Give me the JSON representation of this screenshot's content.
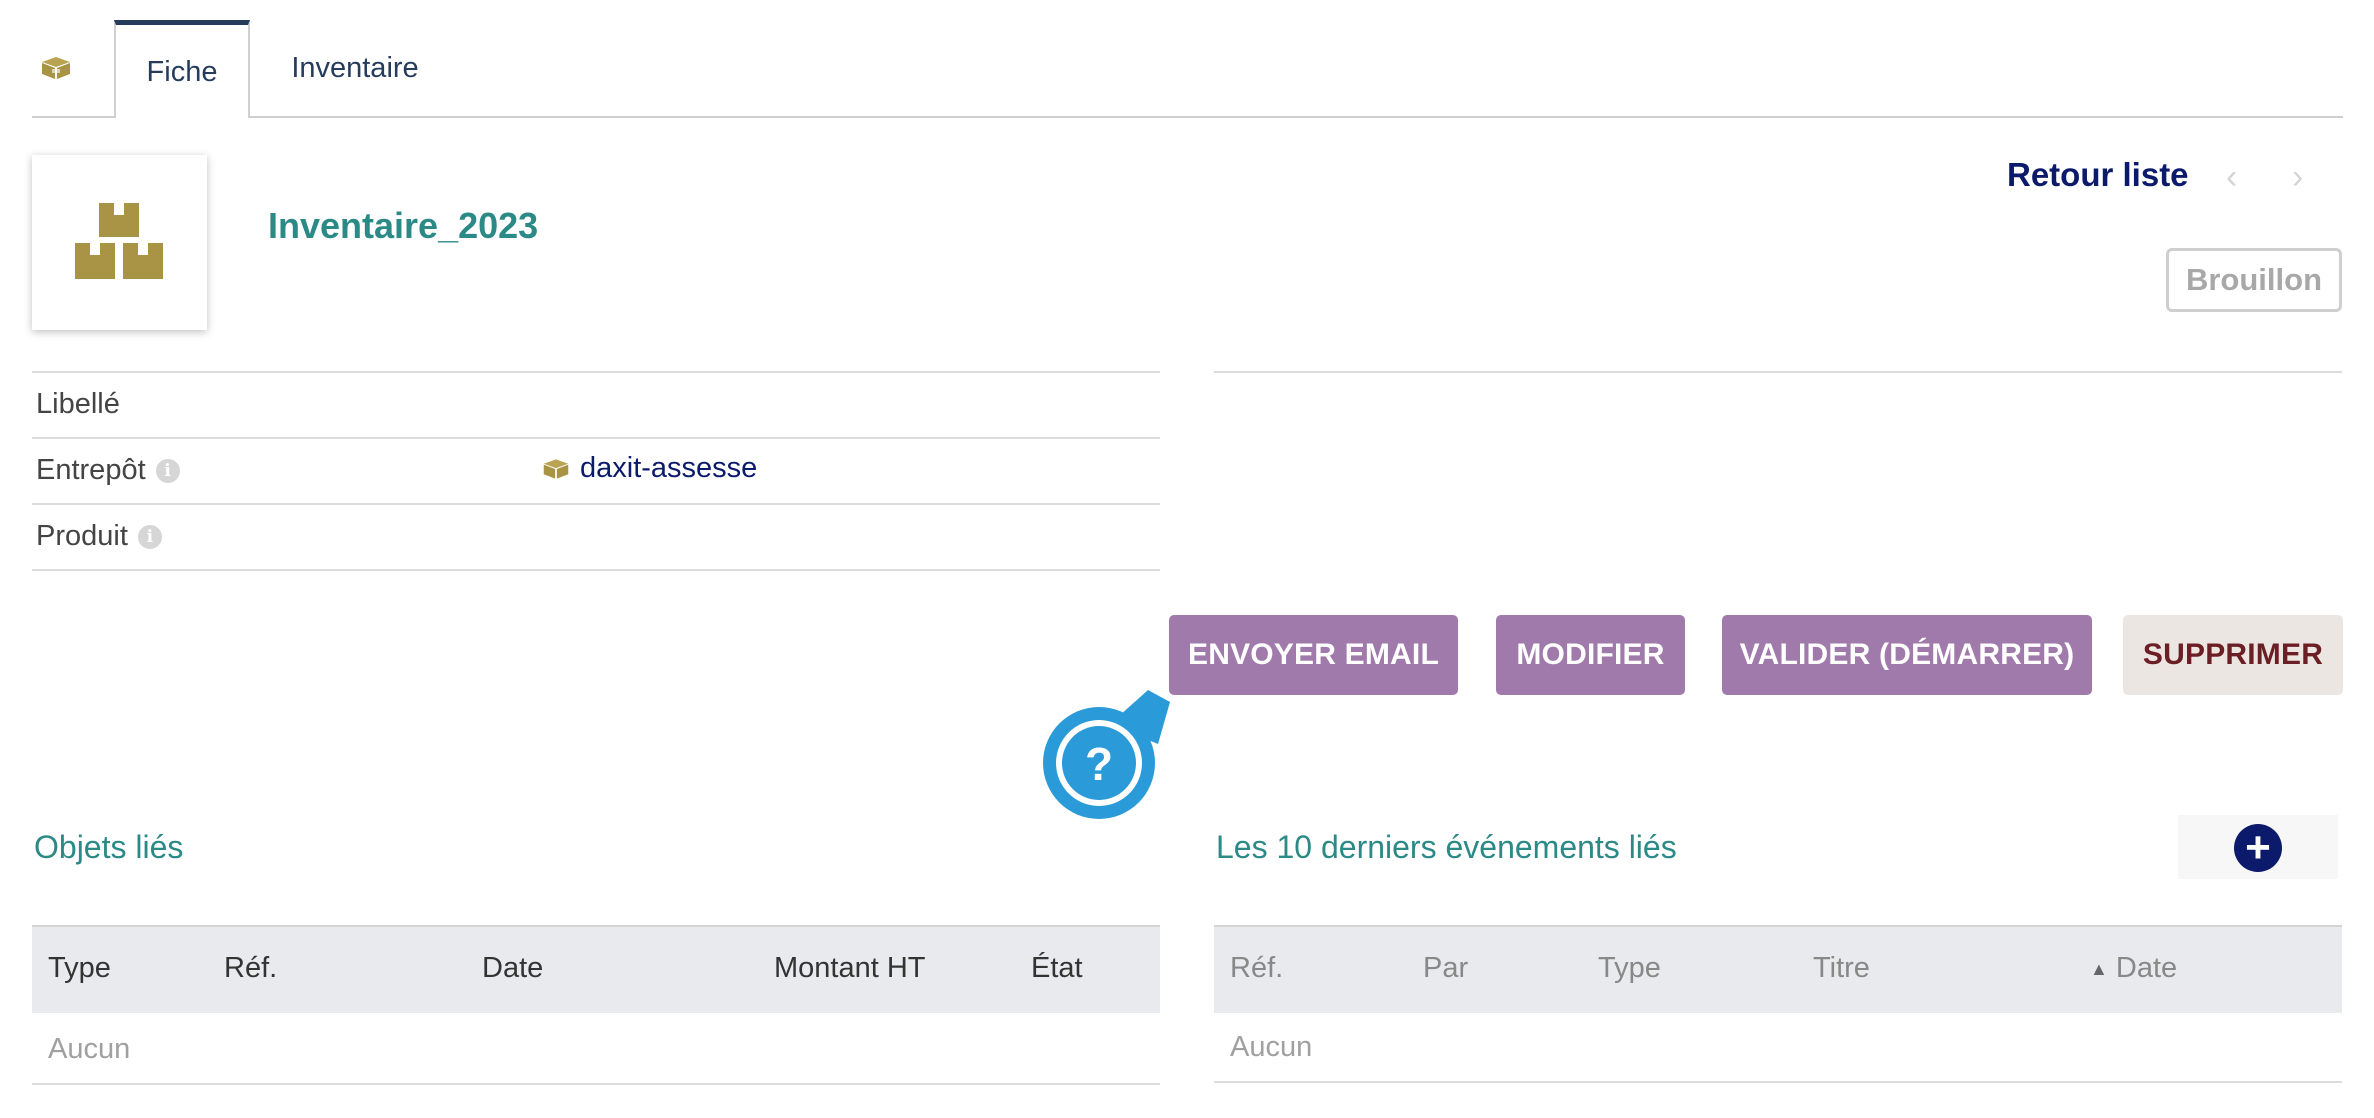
{
  "tabs": [
    {
      "label": "Fiche",
      "active": true
    },
    {
      "label": "Inventaire",
      "active": false
    }
  ],
  "tab_icon": "boxes-icon",
  "object": {
    "ref": "Inventaire_2023",
    "thumbnail_icon": "boxes-icon",
    "status": "Brouillon"
  },
  "nav": {
    "back_label": "Retour liste",
    "prev_icon": "chevron-left-icon",
    "next_icon": "chevron-right-icon"
  },
  "fields": [
    {
      "label": "Libellé",
      "value": ""
    },
    {
      "label": "Entrepôt",
      "value": "daxit-assesse",
      "info_icon": "info-icon"
    },
    {
      "label": "Produit",
      "value": "",
      "info_icon": "info-icon"
    }
  ],
  "actions": {
    "send_email": "ENVOYER EMAIL",
    "modify": "MODIFIER",
    "validate": "VALIDER (DÉMARRER)",
    "delete": "SUPPRIMER"
  },
  "help": {
    "symbol": "?"
  },
  "linked_objects": {
    "title": "Objets liés",
    "columns": [
      "Type",
      "Réf.",
      "Date",
      "Montant HT",
      "État"
    ],
    "empty_text": "Aucun"
  },
  "events": {
    "title": "Les 10 derniers événements liés",
    "columns": [
      "Réf.",
      "Par",
      "Type",
      "Titre",
      "Date"
    ],
    "sort_column": "Date",
    "sort_direction": "asc",
    "empty_text": "Aucun",
    "add_icon": "plus-circle-icon"
  },
  "colors": {
    "nav_dark": "#263c5c",
    "teal": "#2b8a86",
    "navy": "#0b1a6a",
    "button_purple": "#a07aab",
    "icon_gold": "#a89444",
    "help_blue": "#2a9ad8"
  }
}
